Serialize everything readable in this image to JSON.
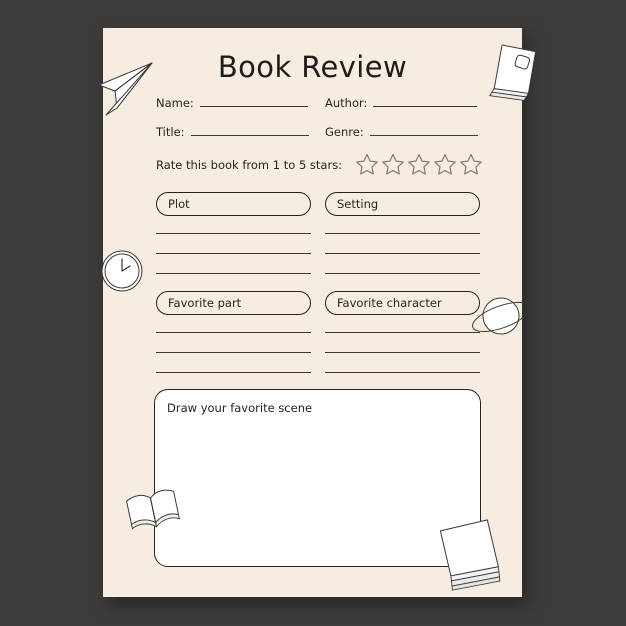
{
  "page": {
    "title": "Book Review",
    "background_color": "#3d3c3b",
    "sheet_color": "#f6ece0",
    "ink_color": "#262522",
    "star_color": "#8a7d70"
  },
  "fields": [
    {
      "id": "name",
      "label": "Name:"
    },
    {
      "id": "author",
      "label": "Author:"
    },
    {
      "id": "title",
      "label": "Title:"
    },
    {
      "id": "genre",
      "label": "Genre:"
    }
  ],
  "rating": {
    "label": "Rate this book from 1 to 5 stars:",
    "star_count": 5,
    "stars_filled": 0,
    "icon": "star-outline-icon"
  },
  "sections": [
    {
      "id": "plot",
      "label": "Plot",
      "lines": 3
    },
    {
      "id": "setting",
      "label": "Setting",
      "lines": 3
    },
    {
      "id": "fav_part",
      "label": "Favorite part",
      "lines": 3
    },
    {
      "id": "fav_character",
      "label": "Favorite character",
      "lines": 3
    }
  ],
  "draw_area": {
    "label": "Draw your favorite scene",
    "fill": "#ffffff"
  },
  "decorations": [
    {
      "id": "paper-plane",
      "icon": "paper-plane-icon"
    },
    {
      "id": "book-top-right",
      "icon": "closed-book-icon"
    },
    {
      "id": "clock",
      "icon": "clock-icon"
    },
    {
      "id": "planet",
      "icon": "planet-saturn-icon"
    },
    {
      "id": "open-book",
      "icon": "open-book-icon"
    },
    {
      "id": "book-bottom-right",
      "icon": "closed-book-icon"
    }
  ]
}
